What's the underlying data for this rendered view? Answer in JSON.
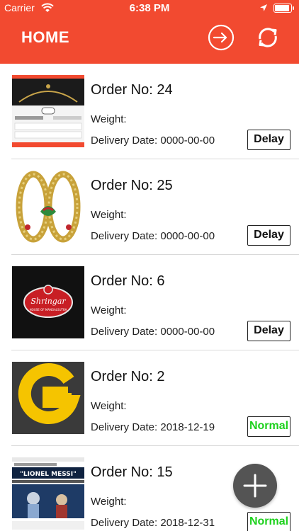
{
  "status_bar": {
    "carrier": "Carrier",
    "time": "6:38 PM"
  },
  "nav": {
    "title": "HOME",
    "logout_icon": "logout-icon",
    "refresh_icon": "refresh-icon"
  },
  "orders": [
    {
      "order_label": "Order No: 24",
      "weight_label": "Weight:",
      "delivery_label": "Delivery Date: 0000-00-00",
      "status": "Delay",
      "thumbnail": "app-screenshot-thumbnail"
    },
    {
      "order_label": "Order No: 25",
      "weight_label": "Weight:",
      "delivery_label": "Delivery Date: 0000-00-00",
      "status": "Delay",
      "thumbnail": "bangles-thumbnail"
    },
    {
      "order_label": "Order No: 6",
      "weight_label": "Weight:",
      "delivery_label": "Delivery Date: 0000-00-00",
      "status": "Delay",
      "thumbnail": "shringar-logo-thumbnail"
    },
    {
      "order_label": "Order No: 2",
      "weight_label": "Weight:",
      "delivery_label": "Delivery Date: 2018-12-19",
      "status": "Normal",
      "thumbnail": "letter-g-thumbnail"
    },
    {
      "order_label": "Order No: 15",
      "weight_label": "Weight:",
      "delivery_label": "Delivery Date: 2018-12-31",
      "status": "Normal",
      "thumbnail": "lionel-messi-thumbnail"
    }
  ],
  "thumb_texts": {
    "shringar_brand": "Shringar",
    "shringar_tag": "HOUSE OF MANGALSUTRA",
    "messi_headline": "\"LIONEL MESSI\""
  },
  "fab": {
    "icon": "plus-icon"
  },
  "colors": {
    "header": "#f24a30",
    "normal_status": "#1dd11d",
    "fab": "#545454"
  }
}
